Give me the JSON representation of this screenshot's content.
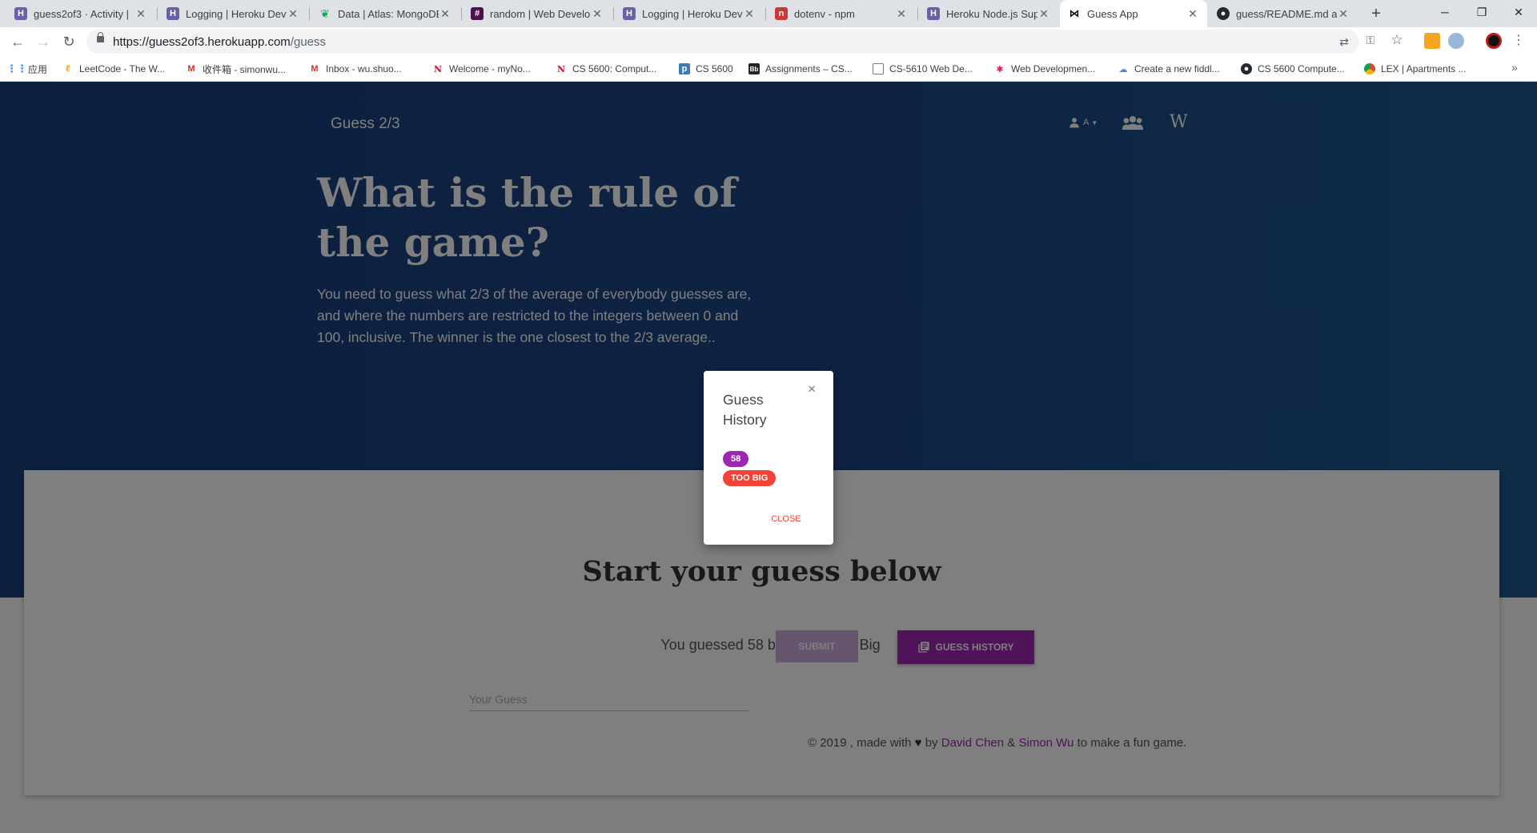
{
  "browser": {
    "tabs": [
      {
        "title": "guess2of3 · Activity |",
        "icon": "heroku-icon",
        "color": "#6762a6"
      },
      {
        "title": "Logging | Heroku Dev",
        "icon": "heroku-icon",
        "color": "#6762a6"
      },
      {
        "title": "Data | Atlas: MongoDB",
        "icon": "mongodb-leaf-icon",
        "color": "#13aa52"
      },
      {
        "title": "random | Web Develo",
        "icon": "slack-icon",
        "color": "#4a154b"
      },
      {
        "title": "Logging | Heroku Dev",
        "icon": "heroku-icon",
        "color": "#6762a6"
      },
      {
        "title": "dotenv - npm",
        "icon": "npm-icon",
        "color": "#cb3837"
      },
      {
        "title": "Heroku Node.js Supp",
        "icon": "heroku-icon",
        "color": "#6762a6"
      },
      {
        "title": "Guess App",
        "icon": "react-icon",
        "color": "#000000",
        "active": true
      },
      {
        "title": "guess/README.md at",
        "icon": "github-icon",
        "color": "#24292e"
      }
    ],
    "url_host": "https://guess2of3.herokuapp.com",
    "url_path": "/guess",
    "bookmarks": [
      {
        "label": "应用",
        "icon": "apps-grid-icon"
      },
      {
        "label": "LeetCode - The W...",
        "icon": "leetcode-icon"
      },
      {
        "label": "收件箱 - simonwu...",
        "icon": "gmail-icon"
      },
      {
        "label": "Inbox - wu.shuo...",
        "icon": "gmail-icon"
      },
      {
        "label": "Welcome - myNo...",
        "icon": "northeastern-icon"
      },
      {
        "label": "CS 5600: Comput...",
        "icon": "northeastern-icon"
      },
      {
        "label": "CS 5600",
        "icon": "piazza-icon"
      },
      {
        "label": "Assignments – CS...",
        "icon": "blackboard-icon"
      },
      {
        "label": "CS-5610 Web De...",
        "icon": "page-icon"
      },
      {
        "label": "Web Developmen...",
        "icon": "slack-icon"
      },
      {
        "label": "Create a new fiddl...",
        "icon": "jsfiddle-icon"
      },
      {
        "label": "CS 5600 Compute...",
        "icon": "github-icon"
      },
      {
        "label": "LEX | Apartments ...",
        "icon": "chrome-icon"
      }
    ]
  },
  "nav": {
    "brand": "Guess 2/3",
    "account_letter": "A"
  },
  "hero": {
    "title": "What is the rule of the game?",
    "description": "You need to guess what 2/3 of the average of everybody guesses are, and where the numbers are restricted to the integers between 0 and 100, inclusive. The winner is the one closest to the 2/3 average.."
  },
  "game": {
    "heading": "Start your guess below",
    "result_message": "You guessed 58 but it was Too Big",
    "input_placeholder": "Your Guess",
    "submit_label": "Submit",
    "history_label": "Guess History"
  },
  "modal": {
    "title": "Guess History",
    "entries": [
      {
        "value": "58",
        "status": "TOO BIG"
      }
    ],
    "close_label": "Close",
    "close_symbol": "×"
  },
  "footer": {
    "prefix": "© 2019 , made with",
    "by": "by",
    "author1": "David Chen",
    "amp": "&",
    "author2": "Simon Wu",
    "suffix": "to make a fun game."
  },
  "colors": {
    "hero_bg": "#1d4587",
    "primary": "#9c27b0",
    "danger": "#f44336"
  }
}
